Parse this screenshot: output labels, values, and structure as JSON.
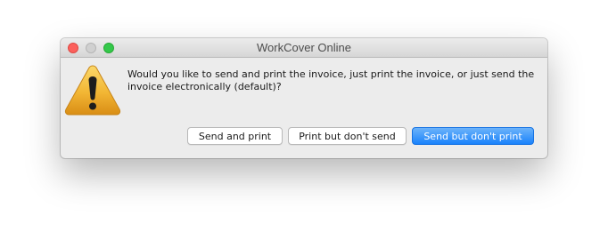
{
  "window": {
    "title": "WorkCover Online"
  },
  "dialog": {
    "icon": "warning-triangle-icon",
    "message": "Would you like to send and print the invoice, just print the invoice, or just send the invoice electronically (default)?",
    "buttons": {
      "send_and_print": "Send and print",
      "print_but_dont_send": "Print but don't send",
      "send_but_dont_print": "Send but don't print"
    }
  },
  "colors": {
    "close": "#fc605c",
    "minimize": "#d0d0d0",
    "zoom": "#34c84a",
    "default_button": "#1a82fb",
    "warning": "#f0b52e"
  }
}
